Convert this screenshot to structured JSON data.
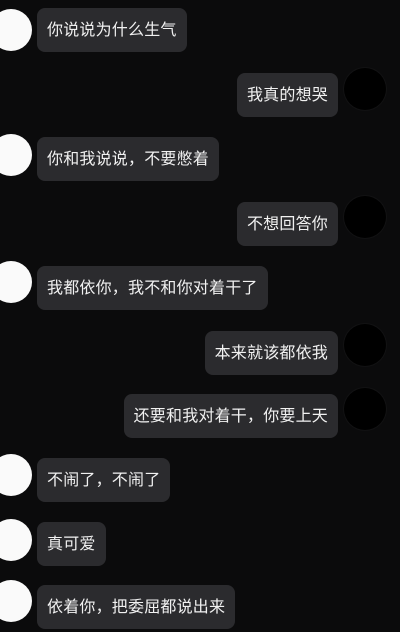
{
  "conversation": {
    "messages": [
      {
        "side": "left",
        "text": "你说说为什么生气"
      },
      {
        "side": "right",
        "text": "我真的想哭"
      },
      {
        "side": "left",
        "text": "你和我说说，不要憋着"
      },
      {
        "side": "right",
        "text": "不想回答你"
      },
      {
        "side": "left",
        "text": "我都依你，我不和你对着干了"
      },
      {
        "side": "right",
        "text": "本来就该都依我"
      },
      {
        "side": "right",
        "text": "还要和我对着干，你要上天"
      },
      {
        "side": "left",
        "text": "不闹了，不闹了"
      },
      {
        "side": "left",
        "text": "真可爱"
      },
      {
        "side": "left",
        "text": "依着你，把委屈都说出来"
      }
    ]
  },
  "colors": {
    "background": "#0b0b0c",
    "bubble": "#2b2b2e",
    "text": "#f1f1f1",
    "left_avatar": "#fafafa",
    "right_avatar": "#000000"
  }
}
